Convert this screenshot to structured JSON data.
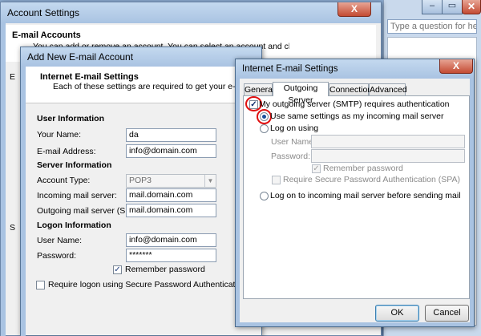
{
  "help": {
    "placeholder": "Type a question for help"
  },
  "account_settings": {
    "title": "Account Settings",
    "heading": "E-mail Accounts",
    "description": "You can add or remove an account. You can select an account and change its settings.",
    "close_label": "X"
  },
  "add_account": {
    "title": "Add New E-mail Account",
    "heading": "Internet E-mail Settings",
    "subheading": "Each of these settings are required to get your e-mail account working.",
    "user_info": {
      "title": "User Information",
      "name_label": "Your Name:",
      "name_value": "da",
      "email_label": "E-mail Address:",
      "email_value": "info@domain.com"
    },
    "server_info": {
      "title": "Server Information",
      "account_type_label": "Account Type:",
      "account_type_value": "POP3",
      "incoming_label": "Incoming mail server:",
      "incoming_value": "mail.domain.com",
      "outgoing_label": "Outgoing mail server (SMTP):",
      "outgoing_value": "mail.domain.com"
    },
    "logon_info": {
      "title": "Logon Information",
      "username_label": "User Name:",
      "username_value": "info@domain.com",
      "password_label": "Password:",
      "password_value": "*******",
      "remember_label": "Remember password",
      "remember_checked": "✓",
      "spa_label": "Require logon using Secure Password Authentication (SPA)"
    },
    "side_letters": [
      "E",
      "S"
    ]
  },
  "ies": {
    "title": "Internet E-mail Settings",
    "close_label": "X",
    "tabs": [
      "General",
      "Outgoing Server",
      "Connection",
      "Advanced"
    ],
    "smtp_auth_label": "My outgoing server (SMTP) requires authentication",
    "smtp_auth_checked": "✓",
    "same_settings_label": "Use same settings as my incoming mail server",
    "logon_using_label": "Log on using",
    "username_label": "User Name:",
    "password_label": "Password:",
    "remember_label": "Remember password",
    "remember_checked": "✓",
    "spa_label": "Require Secure Password Authentication (SPA)",
    "logon_before_label": "Log on to incoming mail server before sending mail",
    "ok_label": "OK",
    "cancel_label": "Cancel"
  },
  "colors": {
    "highlight": "#e01010",
    "selection_blue": "#1b4f9c"
  }
}
